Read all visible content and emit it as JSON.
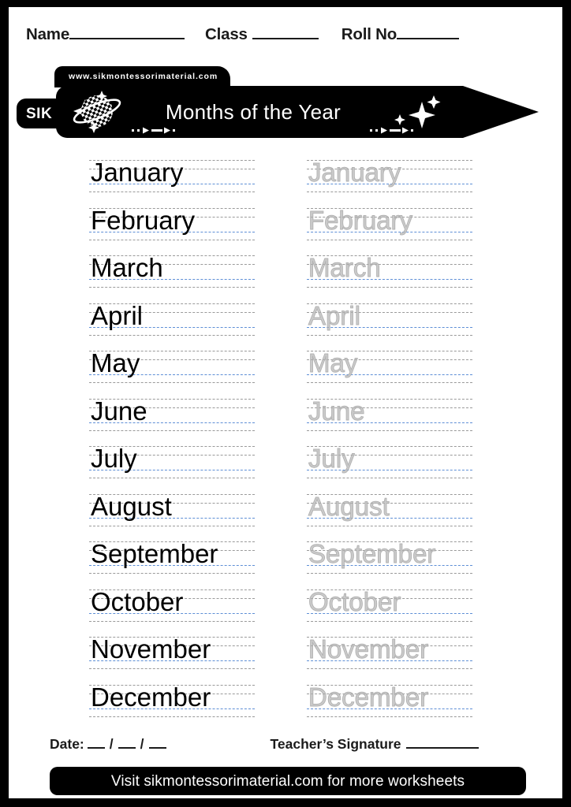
{
  "page": {
    "border_color": "#000000",
    "sheet_color": "#ffffff"
  },
  "header": {
    "name_label": "Name",
    "class_label": "Class",
    "roll_label": "Roll No"
  },
  "banner": {
    "url_text": "www.sikmontessorimaterial.com",
    "brand_tab": "SIK",
    "title": "Months of the Year",
    "logo_icon": "checkered-planet-icon",
    "banner_color": "#000000",
    "title_color": "#ffffff"
  },
  "worksheet": {
    "guide_line_color": "#9a9a9a",
    "baseline_color": "#5e8fd6",
    "solid_text_color": "#000000",
    "trace_text_color": "#aeaeae",
    "rows": [
      {
        "solid": "January",
        "trace": "January"
      },
      {
        "solid": "February",
        "trace": "February"
      },
      {
        "solid": "March",
        "trace": "March"
      },
      {
        "solid": "April",
        "trace": "April"
      },
      {
        "solid": "May",
        "trace": "May"
      },
      {
        "solid": "June",
        "trace": "June"
      },
      {
        "solid": "July",
        "trace": "July"
      },
      {
        "solid": "August",
        "trace": "August"
      },
      {
        "solid": "September",
        "trace": "September"
      },
      {
        "solid": "October",
        "trace": "October"
      },
      {
        "solid": "November",
        "trace": "November"
      },
      {
        "solid": "December",
        "trace": "December"
      }
    ]
  },
  "footer": {
    "date_label": "Date:",
    "date_separator": "/",
    "signature_label": "Teacher’s Signature",
    "promo_text": "Visit sikmontessorimaterial.com for more worksheets",
    "promo_bg": "#000000",
    "promo_color": "#ffffff"
  }
}
